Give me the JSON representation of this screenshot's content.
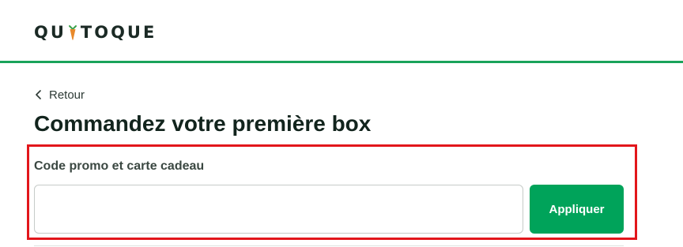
{
  "header": {
    "logo_part1": "QU",
    "logo_part2": "TOQUE",
    "logo_icon": "carrot-icon",
    "accent_color": "#1aa35a"
  },
  "navigation": {
    "back_label": "Retour",
    "back_icon": "chevron-left-icon"
  },
  "page": {
    "title": "Commandez votre première box"
  },
  "promo": {
    "label": "Code promo et carte cadeau",
    "input_value": "",
    "apply_label": "Appliquer",
    "button_color": "#00a35a",
    "highlight_color": "#e2161b"
  }
}
